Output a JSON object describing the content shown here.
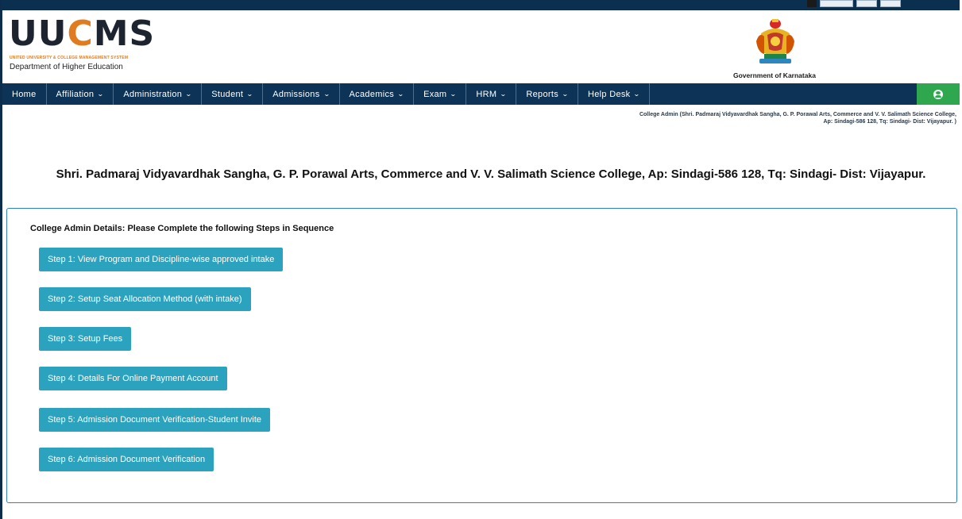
{
  "header": {
    "logo_text_main": "UUCMS",
    "logo_tagline": "UNITED UNIVERSITY & COLLEGE MANAGEMENT SYSTEM",
    "department": "Department of Higher Education",
    "government": "Government of Karnataka"
  },
  "nav": {
    "items": [
      {
        "label": "Home",
        "has_dropdown": false
      },
      {
        "label": "Affiliation",
        "has_dropdown": true
      },
      {
        "label": "Administration",
        "has_dropdown": true
      },
      {
        "label": "Student",
        "has_dropdown": true
      },
      {
        "label": "Admissions",
        "has_dropdown": true
      },
      {
        "label": "Academics",
        "has_dropdown": true
      },
      {
        "label": "Exam",
        "has_dropdown": true
      },
      {
        "label": "HRM",
        "has_dropdown": true
      },
      {
        "label": "Reports",
        "has_dropdown": true
      },
      {
        "label": "Help Desk",
        "has_dropdown": true
      }
    ],
    "dropdown_glyph": "⌄",
    "user_icon": "user-circle-icon",
    "user_bg_color": "#2ea74f",
    "bar_color": "#0d3457"
  },
  "admin_info": "College Admin (Shri. Padmaraj Vidyavardhak Sangha, G. P. Porawal Arts, Commerce and V. V. Salimath Science College, Ap: Sindagi-586 128, Tq: Sindagi- Dist: Vijayapur. )",
  "college_title": "Shri. Padmaraj Vidyavardhak Sangha, G. P. Porawal Arts, Commerce and V. V. Salimath Science College, Ap: Sindagi-586 128, Tq: Sindagi- Dist: Vijayapur.",
  "steps": {
    "heading": "College Admin Details: Please Complete the following Steps in Sequence",
    "button_color": "#2ba3bf",
    "items": [
      "Step 1: View Program and Discipline-wise approved intake",
      "Step 2: Setup Seat Allocation Method (with intake)",
      "Step 3: Setup Fees",
      "Step 4: Details For Online Payment Account",
      "Step 5: Admission Document Verification-Student Invite",
      "Step 6: Admission Document Verification"
    ]
  }
}
